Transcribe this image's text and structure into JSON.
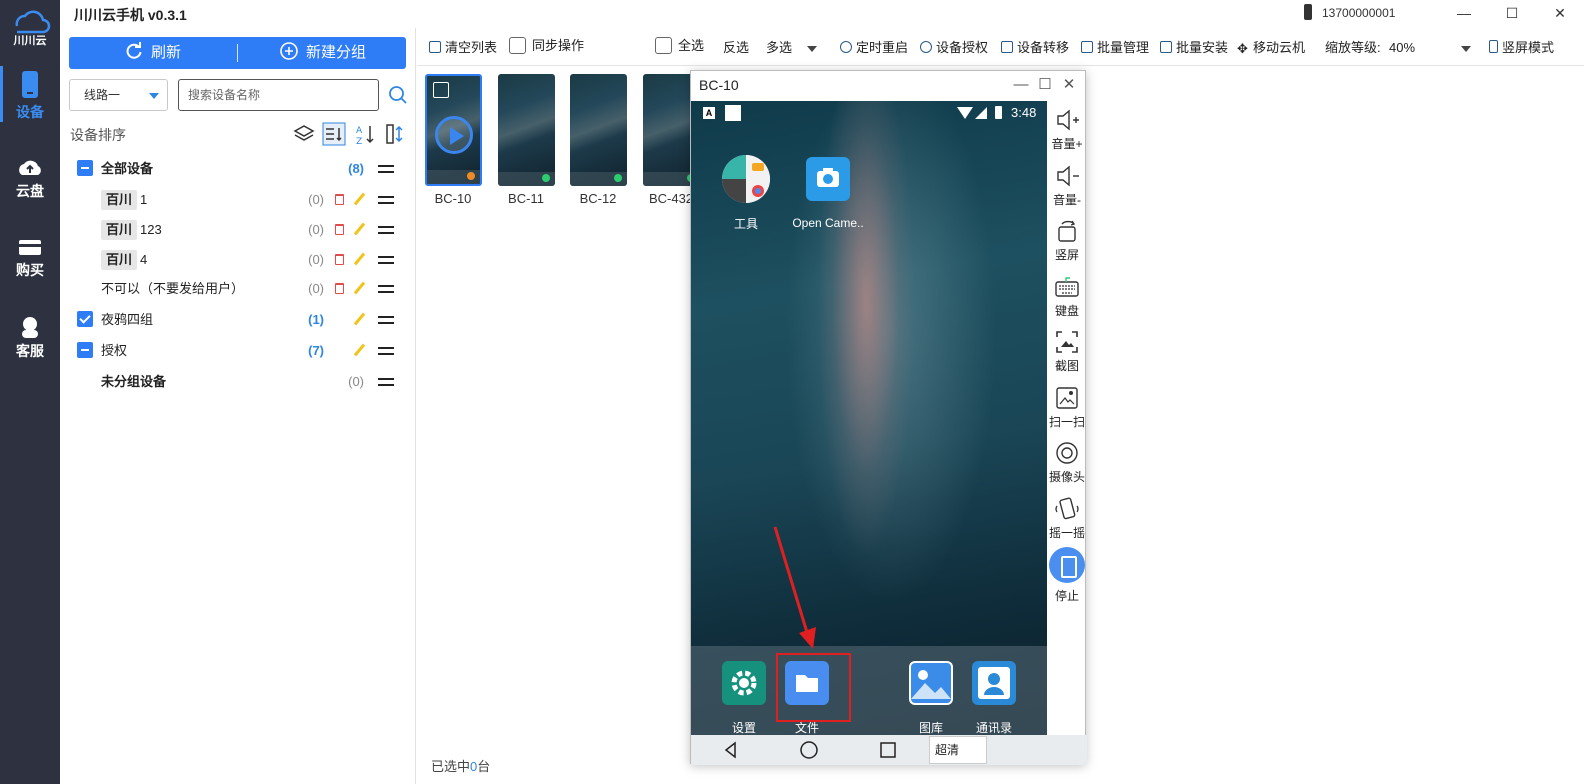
{
  "app": {
    "title": "川川云手机 v0.3.1",
    "account": "13700000001",
    "logo_text": "川川云"
  },
  "window_controls": {
    "minimize": "—",
    "maximize": "☐",
    "close": "✕"
  },
  "rail": [
    {
      "label": "设备",
      "icon": "phone-icon",
      "active": true
    },
    {
      "label": "云盘",
      "icon": "cloud-upload-icon",
      "active": false
    },
    {
      "label": "购买",
      "icon": "card-icon",
      "active": false
    },
    {
      "label": "客服",
      "icon": "headset-icon",
      "active": false
    }
  ],
  "left": {
    "refresh_label": "刷新",
    "new_group_label": "新建分组",
    "route_value": "线路一",
    "search_placeholder": "搜索设备名称",
    "sort_title": "设备排序",
    "tree": [
      {
        "label": "全部设备",
        "count": "(8)"
      },
      {
        "tag": "百川",
        "label": "1",
        "count": "(0)"
      },
      {
        "tag": "百川",
        "label": "123",
        "count": "(0)"
      },
      {
        "tag": "百川",
        "label": "4",
        "count": "(0)"
      },
      {
        "label": "不可以（不要发给用户）",
        "count": "(0)"
      },
      {
        "label": "夜鸦四组",
        "count": "(1)"
      },
      {
        "label": "授权",
        "count": "(7)"
      },
      {
        "label": "未分组设备",
        "count": "(0)"
      }
    ]
  },
  "toolbar": {
    "clear_list": "清空列表",
    "sync_op": "同步操作",
    "select_all": "全选",
    "invert": "反选",
    "multi_select": "多选",
    "timed_restart": "定时重启",
    "device_auth": "设备授权",
    "device_transfer": "设备转移",
    "batch_manage": "批量管理",
    "batch_install": "批量安装",
    "move_cloud": "移动云机",
    "zoom_label": "缩放等级:",
    "zoom_value": "40%",
    "portrait_mode": "竖屏模式"
  },
  "devices": [
    {
      "name": "BC-10",
      "status_color": "#f08a24"
    },
    {
      "name": "BC-11",
      "status_color": "#2ecc71"
    },
    {
      "name": "BC-12",
      "status_color": "#2ecc71"
    },
    {
      "name": "BC-432",
      "status_color": "#2ecc71"
    }
  ],
  "selected_prefix": "已选中",
  "selected_count": "0",
  "selected_suffix": "台",
  "device_window": {
    "title": "BC-10",
    "time": "3:48",
    "status_letter": "A",
    "apps": [
      {
        "label": "工具",
        "icon": "tools-folder-icon"
      },
      {
        "label": "Open Came..",
        "icon": "camera-icon"
      }
    ],
    "dock": [
      {
        "label": "设置",
        "icon": "settings-icon",
        "color": "#16917d"
      },
      {
        "label": "文件",
        "icon": "folder-icon",
        "color": "#4a8df0"
      },
      {
        "label": "图库",
        "icon": "gallery-icon",
        "color": "#3b8be8"
      },
      {
        "label": "通讯录",
        "icon": "contacts-icon",
        "color": "#2b8ad8"
      }
    ],
    "quality": "超清",
    "side_tools": [
      {
        "label": "音量+",
        "icon": "volume-up-icon"
      },
      {
        "label": "音量-",
        "icon": "volume-down-icon"
      },
      {
        "label": "竖屏",
        "icon": "rotate-icon"
      },
      {
        "label": "键盘",
        "icon": "keyboard-icon"
      },
      {
        "label": "截图",
        "icon": "screenshot-icon"
      },
      {
        "label": "扫一扫",
        "icon": "scan-icon"
      },
      {
        "label": "摄像头",
        "icon": "camera-lens-icon"
      },
      {
        "label": "摇一摇",
        "icon": "shake-icon"
      },
      {
        "label": "停止",
        "icon": "stop-icon"
      }
    ]
  }
}
